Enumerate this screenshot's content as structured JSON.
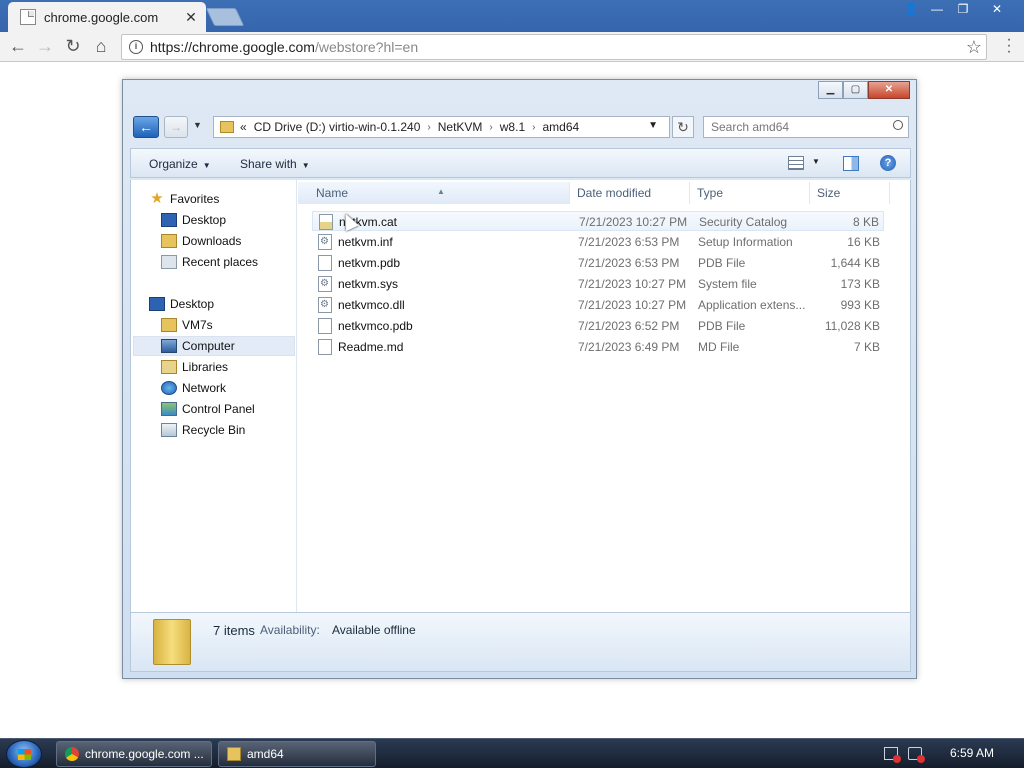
{
  "browser": {
    "tab_title": "chrome.google.com",
    "tab_close": "✕",
    "url_host": "https://chrome.google.com",
    "url_path": "/webstore?hl=en",
    "nav_back": "←",
    "nav_forward": "→",
    "nav_reload": "↻",
    "nav_home": "⌂",
    "star": "☆"
  },
  "explorer": {
    "breadcrumb": {
      "overflow": "«",
      "parts": [
        "CD Drive (D:) virtio-win-0.1.240",
        "NetKVM",
        "w8.1",
        "amd64"
      ]
    },
    "search_placeholder": "Search amd64",
    "toolbar": {
      "organize": "Organize",
      "share_with": "Share with"
    },
    "nav": {
      "favorites": "Favorites",
      "desktop_fav": "Desktop",
      "downloads": "Downloads",
      "recent_places": "Recent places",
      "desktop": "Desktop",
      "vm7s": "VM7s",
      "computer": "Computer",
      "libraries": "Libraries",
      "network": "Network",
      "control_panel": "Control Panel",
      "recycle_bin": "Recycle Bin"
    },
    "columns": {
      "name": "Name",
      "date": "Date modified",
      "type": "Type",
      "size": "Size"
    },
    "files": [
      {
        "name": "netkvm.cat",
        "date": "7/21/2023 10:27 PM",
        "type": "Security Catalog",
        "size": "8 KB"
      },
      {
        "name": "netkvm.inf",
        "date": "7/21/2023 6:53 PM",
        "type": "Setup Information",
        "size": "16 KB"
      },
      {
        "name": "netkvm.pdb",
        "date": "7/21/2023 6:53 PM",
        "type": "PDB File",
        "size": "1,644 KB"
      },
      {
        "name": "netkvm.sys",
        "date": "7/21/2023 10:27 PM",
        "type": "System file",
        "size": "173 KB"
      },
      {
        "name": "netkvmco.dll",
        "date": "7/21/2023 10:27 PM",
        "type": "Application extens...",
        "size": "993 KB"
      },
      {
        "name": "netkvmco.pdb",
        "date": "7/21/2023 6:52 PM",
        "type": "PDB File",
        "size": "11,028 KB"
      },
      {
        "name": "Readme.md",
        "date": "7/21/2023 6:49 PM",
        "type": "MD File",
        "size": "7 KB"
      }
    ],
    "details": {
      "count": "7 items",
      "availability_label": "Availability:",
      "availability_value": "Available offline"
    }
  },
  "taskbar": {
    "chrome_button": "chrome.google.com ...",
    "explorer_button": "amd64",
    "clock": "6:59 AM"
  }
}
